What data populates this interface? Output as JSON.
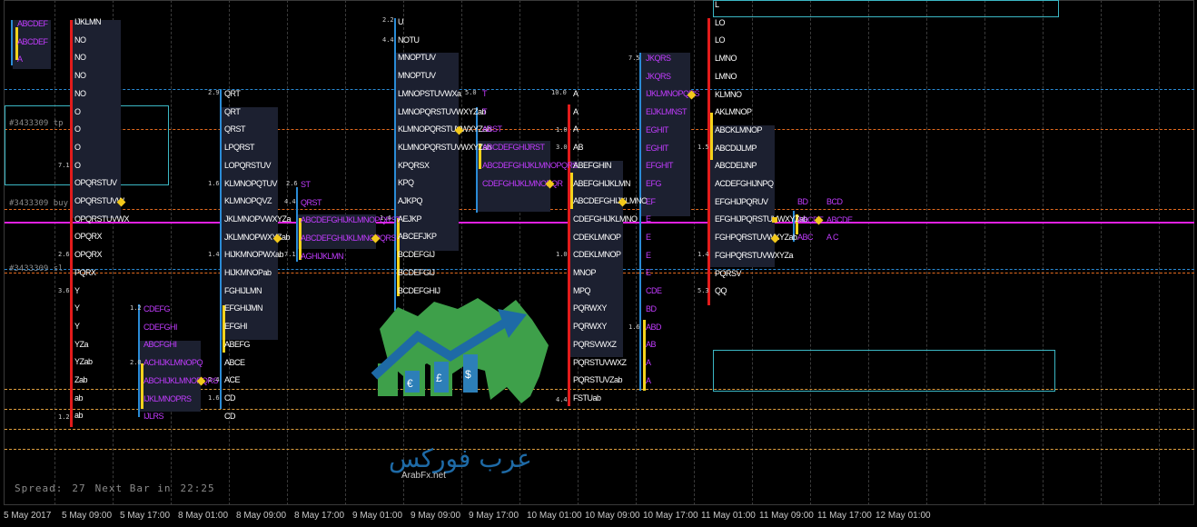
{
  "chart": {
    "status": {
      "spread_label": "Spread:",
      "spread_value": "27",
      "next_bar_label": "Next Bar in",
      "next_bar_value": "22:25"
    },
    "level_tags": {
      "tp": "#3433309 tp",
      "buy": "#3433309 buy",
      "sl": "#3433309 sl"
    },
    "x_axis": [
      "5 May 2017",
      "5 May 09:00",
      "5 May 17:00",
      "8 May 01:00",
      "8 May 09:00",
      "8 May 17:00",
      "9 May 01:00",
      "9 May 09:00",
      "9 May 17:00",
      "10 May 01:00",
      "10 May 09:00",
      "10 May 17:00",
      "11 May 01:00",
      "11 May 09:00",
      "11 May 17:00",
      "12 May 01:00"
    ],
    "profiles": [
      {
        "rows": [
          "ABCDEF",
          "ABCDEF",
          "A"
        ],
        "magenta": true
      },
      {
        "rows": [
          "IJKLMN",
          "NO",
          "NO",
          "NO",
          "NO",
          "O",
          "O",
          "O",
          "O",
          "OPQRSTUV",
          "OPQRSTUVW",
          "OPQRSTUVWX",
          "OPQRX",
          "OPQRX",
          "PQRX",
          "Y",
          "Y",
          "Y",
          "YZa",
          "YZab",
          "Zab",
          "ab",
          "ab"
        ]
      },
      {
        "rows": [
          "CDEFG",
          "CDEFGHI",
          "ABCFGHI",
          "ACHIJKLMNOPQ",
          "ABCHIJKLMNOPQRS",
          "IJKLMNOPRS",
          "IJLRS"
        ],
        "magenta": true
      },
      {
        "rows": [
          "QRT",
          "QRT",
          "QRST",
          "LPQRST",
          "LOPQRSTUV",
          "KLMNOPQTUV",
          "KLMNOPQVZ",
          "JKLMNOPVWXYZa",
          "JKLMNOPWXYZab",
          "HIJKMNOPWXab",
          "HIJKMNOPab",
          "FGHIJLMN",
          "EFGHIJMN",
          "EFGHI",
          "ABEFG",
          "ABCE",
          "ACE",
          "CD",
          "CD"
        ]
      },
      {
        "rows": [
          "ST",
          "QRST",
          "ABCDEFGHIJKLMNOPQRST",
          "ABCDEFGHIJKLMNOPQRS",
          "AGHIJKLMN"
        ],
        "magenta": true
      },
      {
        "rows": [
          "U",
          "NOTU",
          "MNOPTUV",
          "MNOPTUV",
          "LMNOPSTUVWXa",
          "LMNOPQRSTUVWXYZab",
          "KLMNOPQRSTUVWXYZab",
          "KLMNOPQRSTUVWXYZab",
          "KPQRSX",
          "KPQ",
          "AJKPQ",
          "AEJKP",
          "ABCEFJKP",
          "BCDEFGIJ",
          "BCDEFGIJ",
          "BCDEFGHIJ"
        ]
      },
      {
        "rows": [
          "T",
          "T",
          "ABST",
          "ABCDEFGHIJRST",
          "ABCDEFGHIJKLMNOPQRS",
          "CDEFGHIJKLMNOPQR"
        ],
        "magenta": true
      },
      {
        "rows": [
          "A",
          "A",
          "A",
          "AB",
          "ABEFGHIN",
          "ABEFGHIJKLMN",
          "ABCDEFGHIJKLMNO",
          "CDEFGHIJKLMNO",
          "CDEKLMNOP",
          "CDEKLMNOP",
          "MNOP",
          "MPQ",
          "PQRWXY",
          "PQRWXY",
          "PQRSVWXZ",
          "PQRSTUVWXZ",
          "PQRSTUVZab",
          "FSTUab"
        ]
      },
      {
        "rows": [
          "JKQRS",
          "JKQRS",
          "IJKLMNOPQRS",
          "EIJKLMNST",
          "EGHIT",
          "EGHIT",
          "EFGHIT",
          "EFG",
          "EF",
          "E",
          "E",
          "E",
          "E",
          "CDE",
          "BD",
          "ABD",
          "AB",
          "A",
          "A"
        ],
        "magenta": true
      },
      {
        "rows": [
          "L",
          "LO",
          "LO",
          "LMNO",
          "LMNO",
          "KLMNO",
          "AKLMNOP",
          "ABCKLMNOP",
          "ABCDIJLMP",
          "ABCDEIJNP",
          "ACDEFGHIJNPQ",
          "EFGHIJPQRUV",
          "EFGHIJPQRSTUVWXYZab",
          "FGHPQRSTUVWXYZab",
          "FGHPQRSTUVWXYZa",
          "PQRSV",
          "QQ"
        ]
      },
      {
        "rows": [
          "BD",
          "ABCDE",
          "ABC"
        ],
        "magenta": true
      },
      {
        "rows": [
          "BCD",
          "ABCDE",
          "A C"
        ],
        "magenta": true
      }
    ],
    "numbers": [
      "2.2",
      "4.4",
      "7.1",
      "2.6",
      "3.6",
      "1.2",
      "2.9",
      "1.6",
      "2.6",
      "4.4",
      "1.4",
      "1.2",
      "2.0",
      "1.6",
      "2.4",
      "1.4",
      "7.1",
      "5.0",
      "10.0",
      "1.0",
      "3.0",
      "1.0",
      "4.4",
      "7.5",
      "1.6",
      "1.5",
      "1.4",
      "5.3"
    ],
    "colors": {
      "background": "#000000",
      "poc": "#e21b1b",
      "value_area": "#2a8bd6",
      "yellow": "#f2d31b",
      "letters": "#ffffff",
      "letters_alt": "#c23cff",
      "grid": "#3a3a3a",
      "tp_line": "#2a8bd6",
      "sl_line": "#e46a1e",
      "current_price": "#e020e0"
    },
    "logo": {
      "text_arabic": "عرب فوركس",
      "text_latin": "ArabFx.net"
    }
  }
}
